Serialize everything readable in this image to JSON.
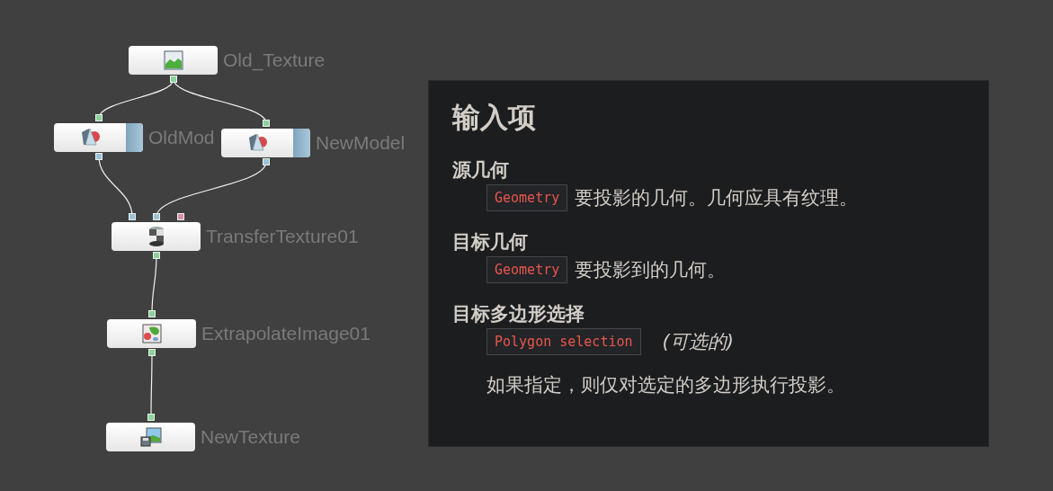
{
  "graph": {
    "nodes": [
      {
        "label": "Old_Texture",
        "kind": "image-input",
        "outputs": [
          {
            "color": "#8fd19e"
          }
        ]
      },
      {
        "label": "OldMod",
        "kind": "model",
        "inputs": [
          {
            "color": "#8fd19e"
          }
        ],
        "outputs": [
          {
            "color": "#9cc3db"
          }
        ]
      },
      {
        "label": "NewModel",
        "kind": "model",
        "inputs": [
          {
            "color": "#8fd19e"
          }
        ],
        "outputs": [
          {
            "color": "#9cc3db"
          }
        ]
      },
      {
        "label": "TransferTexture01",
        "kind": "transfer",
        "inputs": [
          {
            "color": "#9cc3db"
          },
          {
            "color": "#9cc3db"
          },
          {
            "color": "#d98fa8"
          }
        ],
        "outputs": [
          {
            "color": "#8fd19e"
          }
        ]
      },
      {
        "label": "ExtrapolateImage01",
        "kind": "extrapolate",
        "inputs": [
          {
            "color": "#8fd19e"
          }
        ],
        "outputs": [
          {
            "color": "#8fd19e"
          }
        ]
      },
      {
        "label": "NewTexture",
        "kind": "image-output",
        "inputs": [
          {
            "color": "#8fd19e"
          }
        ]
      }
    ]
  },
  "doc": {
    "heading": "输入项",
    "params": [
      {
        "title": "源几何",
        "type": "Geometry",
        "description": "要投影的几何。几何应具有纹理。"
      },
      {
        "title": "目标几何",
        "type": "Geometry",
        "description": "要投影到的几何。"
      },
      {
        "title": "目标多边形选择",
        "type": "Polygon selection",
        "note": "(可选的)",
        "detail": "如果指定，则仅对选定的多边形执行投影。"
      }
    ]
  }
}
